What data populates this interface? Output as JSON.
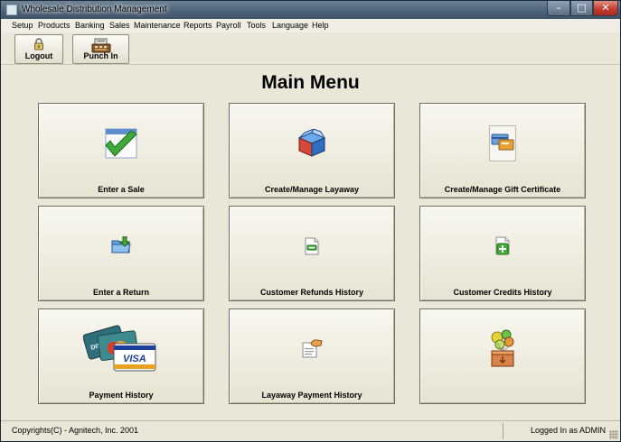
{
  "window": {
    "title": "Wholesale Distribution Management",
    "minimize_glyph": "–",
    "maximize_glyph": "□",
    "close_glyph": "✕"
  },
  "menu": {
    "items": [
      "Setup",
      "Products",
      "Banking",
      "Sales",
      "Maintenance",
      "Reports",
      "Payroll",
      "Tools",
      "Language",
      "Help"
    ]
  },
  "toolbar": {
    "logout_label": "Logout",
    "punch_in_label": "Punch In",
    "logout_icon": "lock-icon",
    "punch_in_icon": "cash-register-icon"
  },
  "main": {
    "title": "Main Menu",
    "tiles": [
      {
        "label": "Enter a Sale",
        "icon": "checkmark-icon"
      },
      {
        "label": "Create/Manage Layaway",
        "icon": "package-box-icon"
      },
      {
        "label": "Create/Manage Gift Certificate",
        "icon": "gift-card-icon"
      },
      {
        "label": "Enter a Return",
        "icon": "folder-arrow-icon"
      },
      {
        "label": "Customer Refunds History",
        "icon": "document-minus-icon"
      },
      {
        "label": "Customer Credits History",
        "icon": "document-plus-icon"
      },
      {
        "label": "Payment History",
        "icon": "credit-cards-icon"
      },
      {
        "label": "Layaway Payment History",
        "icon": "document-hand-icon"
      },
      {
        "label": "",
        "icon": "balloons-box-icon"
      }
    ]
  },
  "status": {
    "copyright": "Copyrights(C) - Agnitech, Inc. 2001",
    "logged_in": "Logged In as ADMIN"
  },
  "colors": {
    "window_bg": "#ebe7d8",
    "titlebar": "#4d6176",
    "close_button": "#c1392b",
    "tile_border": "#6e6a5c"
  }
}
